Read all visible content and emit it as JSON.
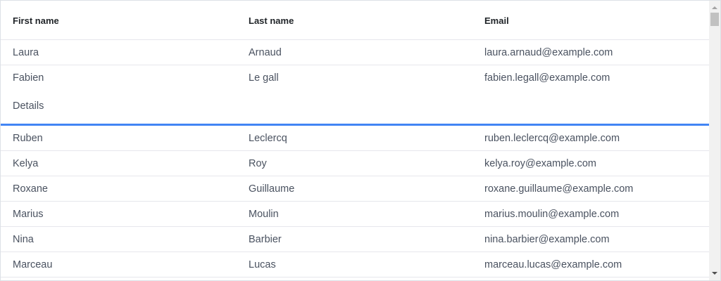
{
  "columns": [
    "First name",
    "Last name",
    "Email"
  ],
  "rows": [
    [
      "Laura",
      "Arnaud",
      "laura.arnaud@example.com"
    ],
    [
      "Fabien",
      "Le gall",
      "fabien.legall@example.com"
    ],
    [
      "Ruben",
      "Leclercq",
      "ruben.leclercq@example.com"
    ],
    [
      "Kelya",
      "Roy",
      "kelya.roy@example.com"
    ],
    [
      "Roxane",
      "Guillaume",
      "roxane.guillaume@example.com"
    ],
    [
      "Marius",
      "Moulin",
      "marius.moulin@example.com"
    ],
    [
      "Nina",
      "Barbier",
      "nina.barbier@example.com"
    ],
    [
      "Marceau",
      "Lucas",
      "marceau.lucas@example.com"
    ]
  ],
  "expanded_row_index": 1,
  "details_label": "Details",
  "colors": {
    "accent": "#4285f4",
    "text": "#4a5260",
    "header_text": "#212529"
  }
}
